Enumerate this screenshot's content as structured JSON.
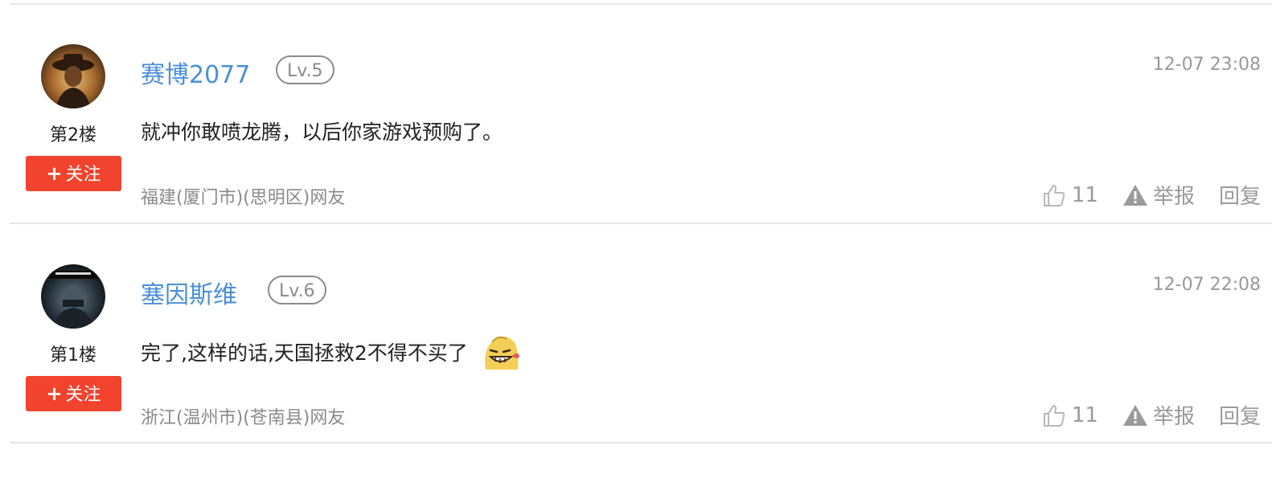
{
  "comments": [
    {
      "username": "赛博2077",
      "level": "Lv.5",
      "floor": "第2楼",
      "follow_label": "关注",
      "follow_icon": "plus-icon",
      "time": "12-07 23:08",
      "content": "就冲你敢喷龙腾，以后你家游戏预购了。",
      "location": "福建(厦门市)(思明区)网友",
      "likes": "11",
      "report_label": "举报",
      "reply_label": "回复"
    },
    {
      "username": "塞因斯维",
      "level": "Lv.6",
      "floor": "第1楼",
      "follow_label": "关注",
      "follow_icon": "plus-icon",
      "time": "12-07 22:08",
      "content": "完了,这样的话,天国拯救2不得不买了",
      "emoji": "grinning-emoji",
      "location": "浙江(温州市)(苍南县)网友",
      "likes": "11",
      "report_label": "举报",
      "reply_label": "回复"
    }
  ],
  "colors": {
    "username": "#4a8fd8",
    "follow_button": "#f2432e",
    "muted": "#999999",
    "divider": "#e6e6e6"
  }
}
